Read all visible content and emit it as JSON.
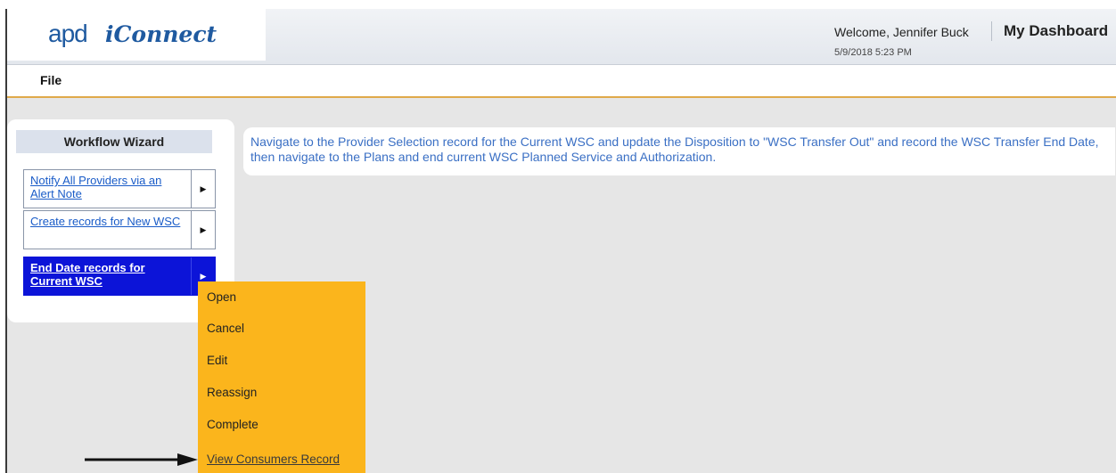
{
  "header": {
    "logo_apd": "apd",
    "logo_iconnect": "iConnect",
    "welcome": "Welcome, Jennifer Buck",
    "timestamp": "5/9/2018 5:23 PM",
    "dashboard": "My Dashboard"
  },
  "menubar": {
    "file": "File"
  },
  "wizard": {
    "title": "Workflow Wizard",
    "items": [
      {
        "label": "Notify All Providers via an Alert Note",
        "selected": false
      },
      {
        "label": "Create records for New WSC",
        "selected": false
      },
      {
        "label": "End Date records for Current WSC",
        "selected": true
      }
    ]
  },
  "instructions": {
    "text": "Navigate to the Provider Selection record for the Current WSC and update the Disposition to \"WSC Transfer Out\" and record the WSC Transfer End Date, then navigate to the Plans and end current WSC Planned Service and Authorization."
  },
  "context_menu": {
    "items": [
      "Open",
      "Cancel",
      "Edit",
      "Reassign",
      "Complete",
      "View Consumers Record"
    ]
  },
  "colors": {
    "accent_blue": "#1a5cc8",
    "selected_blue": "#0c14d8",
    "menu_orange": "#fbb51c",
    "header_gold_line": "#e0a94a"
  },
  "icons": {
    "submenu_arrow": "right-triangle-icon",
    "pointer": "black-arrow-icon"
  }
}
